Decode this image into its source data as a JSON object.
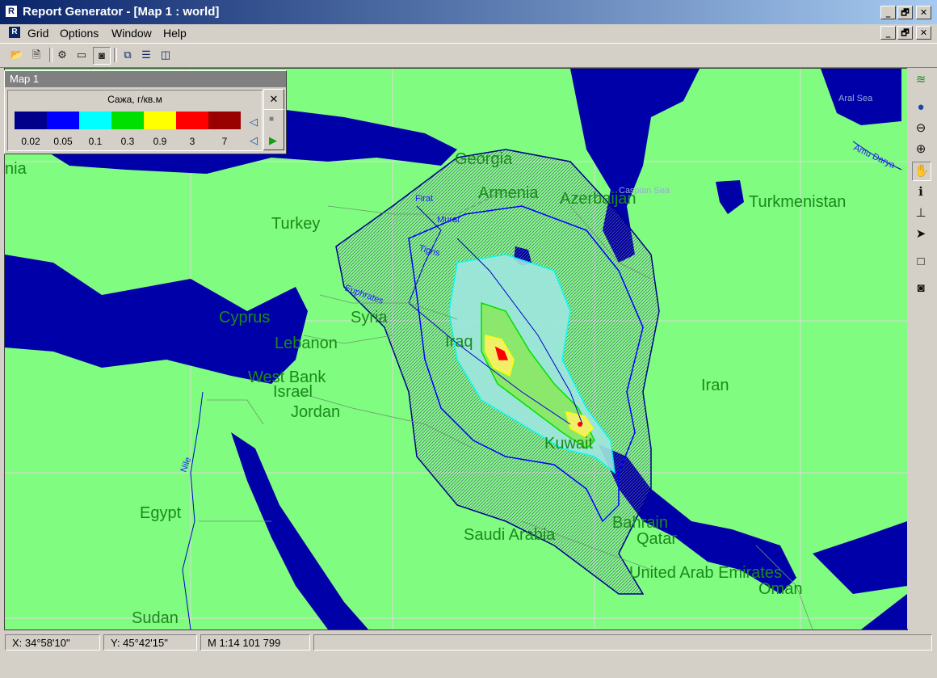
{
  "window": {
    "title": "Report Generator - [Map 1 :   world]",
    "app_icon": "R",
    "controls": [
      "_",
      "🗗",
      "✕"
    ]
  },
  "menu": {
    "icon": "R",
    "items": [
      "Grid",
      "Options",
      "Window",
      "Help"
    ]
  },
  "toolbar": {
    "icons": [
      "open-folder-icon",
      "properties-icon",
      "settings-gear-icon",
      "book-icon",
      "camera-icon",
      "cascade-windows-icon",
      "tile-horizontal-icon",
      "tile-vertical-icon"
    ]
  },
  "legend": {
    "window_title": "Map 1",
    "substance_label": "Сажа, г/кв.м",
    "close_label": "✕",
    "colors": [
      "#00008b",
      "#0000ff",
      "#00ffff",
      "#00e000",
      "#ffff00",
      "#ff0000",
      "#990000"
    ],
    "values": [
      "0.02",
      "0.05",
      "0.1",
      "0.3",
      "0.9",
      "3",
      "7"
    ]
  },
  "map": {
    "land_color": "#80fc80",
    "water_color": "#0000a8",
    "country_labels": [
      {
        "name": "Georgia"
      },
      {
        "name": "Armenia"
      },
      {
        "name": "Azerbaijan"
      },
      {
        "name": "Turkmenistan"
      },
      {
        "name": "Turkey"
      },
      {
        "name": "Cyprus"
      },
      {
        "name": "Syria"
      },
      {
        "name": "Lebanon"
      },
      {
        "name": "Iraq"
      },
      {
        "name": "West Bank"
      },
      {
        "name": "Israel"
      },
      {
        "name": "Jordan"
      },
      {
        "name": "Iran"
      },
      {
        "name": "Kuwait"
      },
      {
        "name": "Egypt"
      },
      {
        "name": "Saudi Arabia"
      },
      {
        "name": "Bahrain"
      },
      {
        "name": "Qatar"
      },
      {
        "name": "United Arab Emirates"
      },
      {
        "name": "Oman"
      },
      {
        "name": "Sudan"
      },
      {
        "name": "nia"
      }
    ],
    "water_labels": [
      "Aral Sea",
      "Amu Darya",
      "Caspian Sea",
      "Euphrates",
      "Tigris",
      "Nile",
      "Firat",
      "Murat"
    ]
  },
  "right_toolbar": {
    "icons": [
      "layers-icon",
      "globe-icon",
      "zoom-out-icon",
      "zoom-in-icon",
      "pan-hand-icon",
      "info-icon",
      "measure-icon",
      "pointer-icon",
      "rectangle-select-icon",
      "camera-icon"
    ]
  },
  "status": {
    "x": "X: 34°58'10\"",
    "y": "Y: 45°42'15\"",
    "scale": "M 1:14 101 799"
  }
}
